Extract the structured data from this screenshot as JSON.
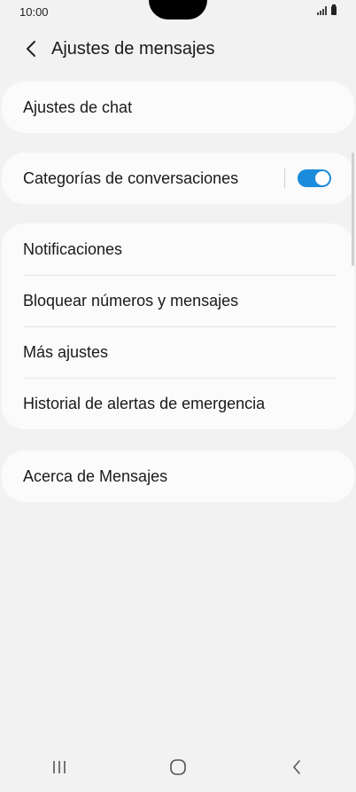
{
  "status_bar": {
    "time": "10:00"
  },
  "header": {
    "back_icon": "chevron-left-icon",
    "title": "Ajustes de mensajes"
  },
  "groups": [
    {
      "items": [
        {
          "label": "Ajustes de chat"
        }
      ]
    },
    {
      "items": [
        {
          "label": "Categorías de conversaciones",
          "toggle": true
        }
      ]
    },
    {
      "items": [
        {
          "label": "Notificaciones"
        },
        {
          "label": "Bloquear números y mensajes"
        },
        {
          "label": "Más ajustes"
        },
        {
          "label": "Historial de alertas de emergencia"
        }
      ]
    },
    {
      "items": [
        {
          "label": "Acerca de Mensajes"
        }
      ]
    }
  ],
  "colors": {
    "accent": "#1a8cdb",
    "background": "#f2f2f2",
    "card": "#fbfbfb"
  },
  "navbar": {
    "icons": [
      "recents-icon",
      "home-icon",
      "back-icon"
    ]
  }
}
